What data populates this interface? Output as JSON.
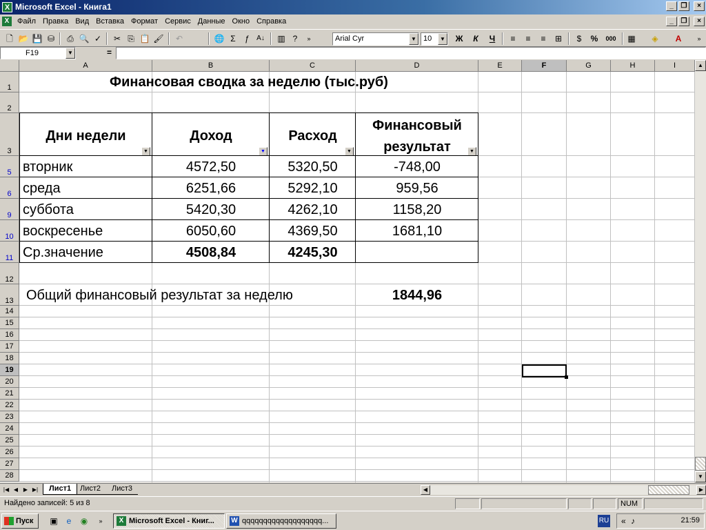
{
  "window": {
    "title": "Microsoft Excel - Книга1",
    "app_icon": "excel-icon"
  },
  "menu": [
    "Файл",
    "Правка",
    "Вид",
    "Вставка",
    "Формат",
    "Сервис",
    "Данные",
    "Окно",
    "Справка"
  ],
  "toolbar": {
    "font_name": "Arial Cyr",
    "font_size": "10",
    "bold": "Ж",
    "italic": "К",
    "underline": "Ч",
    "percent": "%",
    "thousands": "000"
  },
  "formula_bar": {
    "name_box": "F19",
    "equals": "=",
    "value": ""
  },
  "columns": [
    "A",
    "B",
    "C",
    "D",
    "E",
    "F",
    "G",
    "H",
    "I"
  ],
  "selected_column": "F",
  "rows": [
    {
      "label": "1",
      "filtered": false
    },
    {
      "label": "2",
      "filtered": false
    },
    {
      "label": "3",
      "filtered": false
    },
    {
      "label": "5",
      "filtered": true
    },
    {
      "label": "6",
      "filtered": true
    },
    {
      "label": "9",
      "filtered": true
    },
    {
      "label": "10",
      "filtered": true
    },
    {
      "label": "11",
      "filtered": true
    },
    {
      "label": "12",
      "filtered": false
    },
    {
      "label": "13",
      "filtered": false
    },
    {
      "label": "14",
      "filtered": false
    },
    {
      "label": "15",
      "filtered": false
    },
    {
      "label": "16",
      "filtered": false
    },
    {
      "label": "17",
      "filtered": false
    },
    {
      "label": "18",
      "filtered": false
    },
    {
      "label": "19",
      "filtered": false
    },
    {
      "label": "20",
      "filtered": false
    },
    {
      "label": "21",
      "filtered": false
    },
    {
      "label": "22",
      "filtered": false
    },
    {
      "label": "23",
      "filtered": false
    },
    {
      "label": "24",
      "filtered": false
    },
    {
      "label": "25",
      "filtered": false
    },
    {
      "label": "26",
      "filtered": false
    },
    {
      "label": "27",
      "filtered": false
    },
    {
      "label": "28",
      "filtered": false
    }
  ],
  "selected_row": "19",
  "sheet": {
    "title": "Финансовая сводка за неделю (тыс.руб)",
    "headers": [
      "Дни недели",
      "Доход",
      "Расход",
      "Финансовый",
      "результат"
    ],
    "table": [
      {
        "day": "вторник",
        "income": "4572,50",
        "expense": "5320,50",
        "result": "-748,00"
      },
      {
        "day": "среда",
        "income": "6251,66",
        "expense": "5292,10",
        "result": "959,56"
      },
      {
        "day": "суббота",
        "income": "5420,30",
        "expense": "4262,10",
        "result": "1158,20"
      },
      {
        "day": "воскресенье",
        "income": "6050,60",
        "expense": "4369,50",
        "result": "1681,10"
      }
    ],
    "average": {
      "label": "Ср.значение",
      "income": "4508,84",
      "expense": "4245,30"
    },
    "total_label": "Общий финансовый результат за неделю",
    "total_value": "1844,96"
  },
  "sheet_tabs": [
    "Лист1",
    "Лист2",
    "Лист3"
  ],
  "active_tab": "Лист1",
  "status": {
    "text": "Найдено записей: 5 из 8",
    "num": "NUM"
  },
  "taskbar": {
    "start": "Пуск",
    "tasks": [
      "Microsoft Excel - Книг...",
      "qqqqqqqqqqqqqqqqqqq..."
    ],
    "lang": "RU",
    "clock": "21:59"
  }
}
